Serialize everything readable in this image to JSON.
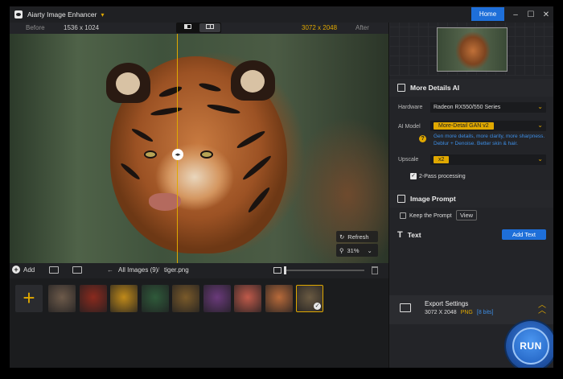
{
  "window": {
    "title": "Aiarty Image Enhancer",
    "home_label": "Home"
  },
  "compare": {
    "before_label": "Before",
    "original_size": "1536 x 1024",
    "output_size": "3072 x 2048",
    "after_label": "After"
  },
  "preview": {
    "refresh_label": "Refresh",
    "zoom": "31%"
  },
  "strip": {
    "add_label": "Add",
    "breadcrumb": "All Images (9)",
    "breadcrumb_sep": "/",
    "current_file": "tiger.png",
    "thumbnails": [
      {
        "name": "woman-portrait",
        "color": "#6d5a4a"
      },
      {
        "name": "insect-macro",
        "color": "#8a2a1e"
      },
      {
        "name": "bee",
        "color": "#c08a1a"
      },
      {
        "name": "hummingbird",
        "color": "#2f5a3a"
      },
      {
        "name": "food-plate",
        "color": "#7a5a2a"
      },
      {
        "name": "colorful-woman",
        "color": "#6a3a7a"
      },
      {
        "name": "clown-woman",
        "color": "#c05a4a"
      },
      {
        "name": "pancakes",
        "color": "#b86a3a"
      },
      {
        "name": "tiger",
        "color": "#6a5a42",
        "selected": true
      }
    ]
  },
  "panel": {
    "details_title": "More Details AI",
    "hardware_label": "Hardware",
    "hardware_value": "Radeon RX550/550 Series",
    "ai_model_label": "AI Model",
    "ai_model_value": "More-Detail GAN v2",
    "ai_model_hint": "Gen more details, more clarity, more sharpness. Deblur + Denoise. Better skin & hair.",
    "upscale_label": "Upscale",
    "upscale_value": "x2",
    "two_pass_label": "2-Pass processing",
    "two_pass_checked": true,
    "prompt_title": "Image Prompt",
    "keep_prompt_label": "Keep the Prompt",
    "keep_prompt_checked": false,
    "view_label": "View",
    "text_title": "Text",
    "add_text_label": "Add Text"
  },
  "export": {
    "title": "Export Settings",
    "size": "3072 X 2048",
    "format": "PNG",
    "bits": "[8 bits]"
  },
  "run_label": "RUN",
  "colors": {
    "accent": "#e0a800",
    "primary": "#1e6fd9",
    "hint": "#3d8ee6"
  }
}
